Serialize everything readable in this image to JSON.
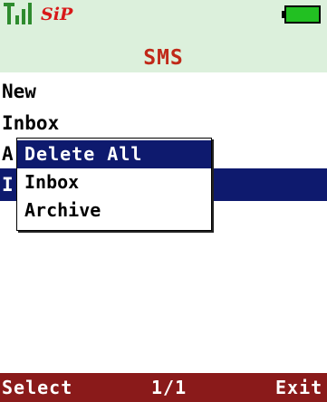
{
  "status_bar": {
    "signal_icon": "signal-strength-icon",
    "service_icon": "sip-logo-icon",
    "service_text": "SiP",
    "battery_icon": "battery-icon"
  },
  "title": "SMS",
  "colors": {
    "header_bg": "#dcf0dc",
    "title": "#c02818",
    "selection": "#0e1a6e",
    "softkey_bar": "#8a1a1a"
  },
  "list": {
    "items": [
      {
        "label": "New"
      },
      {
        "label": "Inbox"
      },
      {
        "label": "A"
      },
      {
        "label": "I"
      }
    ]
  },
  "popup_menu": {
    "items": [
      {
        "label": "Delete All"
      },
      {
        "label": "Inbox"
      },
      {
        "label": "Archive"
      }
    ]
  },
  "softkeys": {
    "left": "Select",
    "center": "1/1",
    "right": "Exit"
  }
}
